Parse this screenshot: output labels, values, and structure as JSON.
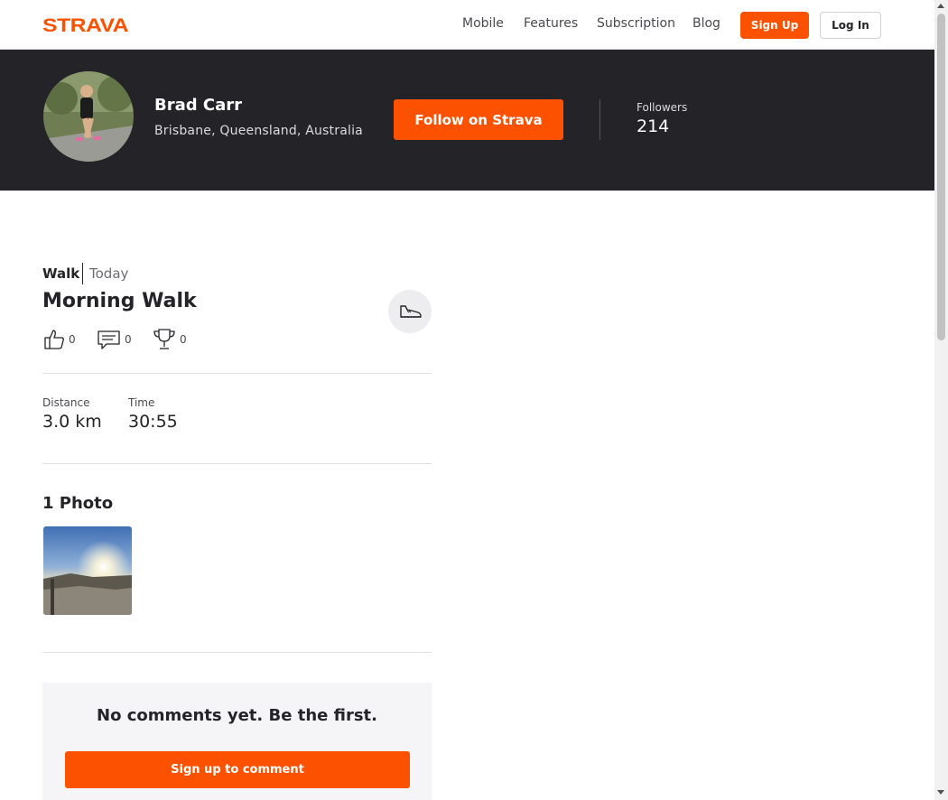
{
  "nav": {
    "logo_text": "STRAVA",
    "links": [
      "Mobile",
      "Features",
      "Subscription",
      "Blog"
    ],
    "signup_label": "Sign Up",
    "login_label": "Log In"
  },
  "athlete": {
    "name": "Brad Carr",
    "location": "Brisbane, Queensland, Australia",
    "follow_label": "Follow on Strava",
    "followers_label": "Followers",
    "followers_count": "214"
  },
  "activity": {
    "type": "Walk",
    "date": "Today",
    "title": "Morning Walk",
    "sport_icon": "shoe-icon",
    "kudos_count": "0",
    "comments_count": "0",
    "achievements_count": "0",
    "stats": [
      {
        "label": "Distance",
        "value": "3.0 km"
      },
      {
        "label": "Time",
        "value": "30:55"
      }
    ],
    "photos_title": "1 Photo"
  },
  "comments": {
    "empty_text": "No comments yet. Be the first.",
    "signup_label": "Sign up to comment"
  },
  "colors": {
    "brand": "#fc5200",
    "header_bg": "#242428",
    "panel_bg": "#f5f5f7"
  }
}
